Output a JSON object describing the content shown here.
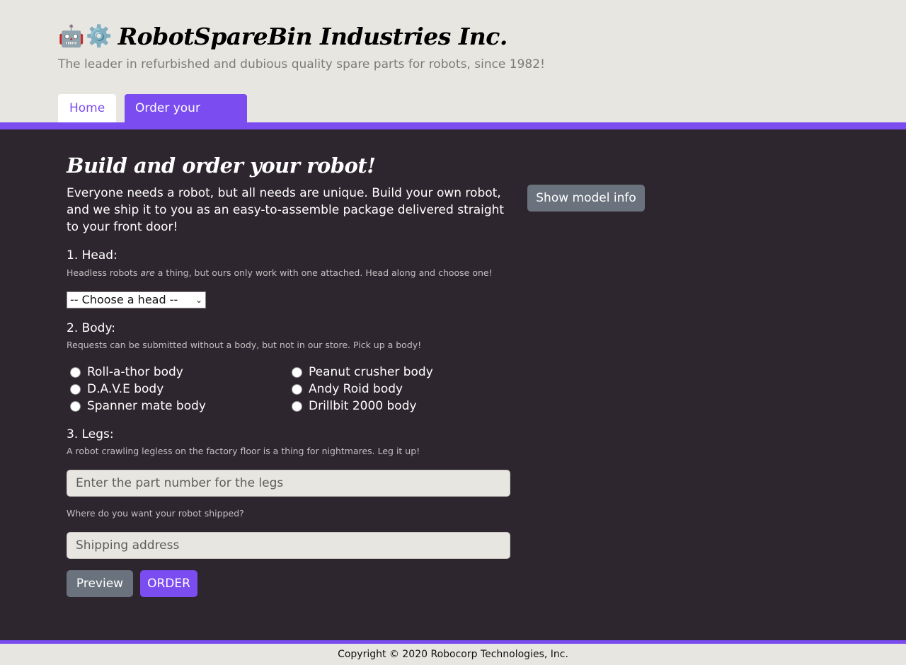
{
  "header": {
    "emoji_robot": "🤖",
    "emoji_gear": "⚙️",
    "title": "RobotSpareBin Industries Inc.",
    "tagline": "The leader in refurbished and dubious quality spare parts for robots, since 1982!"
  },
  "nav": {
    "tabs": [
      {
        "label": "Home"
      },
      {
        "label": "Order your robot!"
      }
    ]
  },
  "main": {
    "heading": "Build and order your robot!",
    "intro": "Everyone needs a robot, but all needs are unique. Build your own robot, and we ship it to you as an easy-to-assemble package delivered straight to your front door!",
    "show_model_info": "Show model info",
    "head": {
      "label": "1. Head:",
      "help_before": "Headless robots ",
      "help_em": "are",
      "help_after": " a thing, but ours only work with one attached. Head along and choose one!",
      "select_value": "-- Choose a head --"
    },
    "body": {
      "label": "2. Body:",
      "help": "Requests can be submitted without a body, but not in our store. Pick up a body!",
      "options": [
        "Roll-a-thor body",
        "Peanut crusher body",
        "D.A.V.E body",
        "Andy Roid body",
        "Spanner mate body",
        "Drillbit 2000 body"
      ]
    },
    "legs": {
      "label": "3. Legs:",
      "help": "A robot crawling legless on the factory floor is a thing for nightmares. Leg it up!",
      "placeholder": "Enter the part number for the legs"
    },
    "address": {
      "help": "Where do you want your robot shipped?",
      "placeholder": "Shipping address"
    },
    "buttons": {
      "preview": "Preview",
      "order": "ORDER"
    }
  },
  "footer": {
    "text": "Copyright © 2020 Robocorp Technologies, Inc."
  },
  "colors": {
    "accent": "#7b4cf0",
    "dark_bg": "#2e262e",
    "light_bg": "#e8e6e1",
    "gray_button": "#6a737d"
  }
}
